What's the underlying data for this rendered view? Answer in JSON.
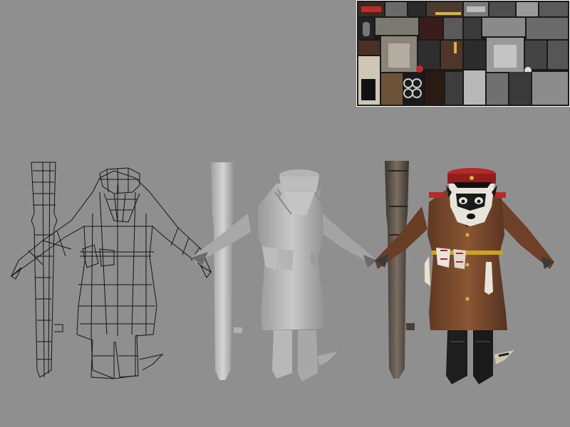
{
  "scene": {
    "background": "#8f8f8f",
    "views": [
      {
        "name": "wireframe",
        "colors": {
          "line": "#141414"
        }
      },
      {
        "name": "clay",
        "colors": {
          "light": "#c8c8c8",
          "mid": "#a9a9a9",
          "dark": "#7a7a7a"
        }
      },
      {
        "name": "textured",
        "colors": {
          "coat": "#7a4a2e",
          "coat_dark": "#4a2a18",
          "cap_band": "#8f1f1f",
          "cap_top": "#b32a2a",
          "boots": "#1e1e1e",
          "tube": "#5a5048",
          "belt": "#c9a227",
          "fur_white": "#e8e4dc",
          "fur_black": "#1a1a1a"
        }
      }
    ]
  },
  "texture_atlas": {
    "palette": {
      "red": "#c0282a",
      "dark": "#1c1c1c",
      "gray": "#5e5e5e",
      "light": "#cfcfcf",
      "brown": "#5a3a26",
      "gold": "#d9b343",
      "steel": "#3a3a3a"
    }
  }
}
